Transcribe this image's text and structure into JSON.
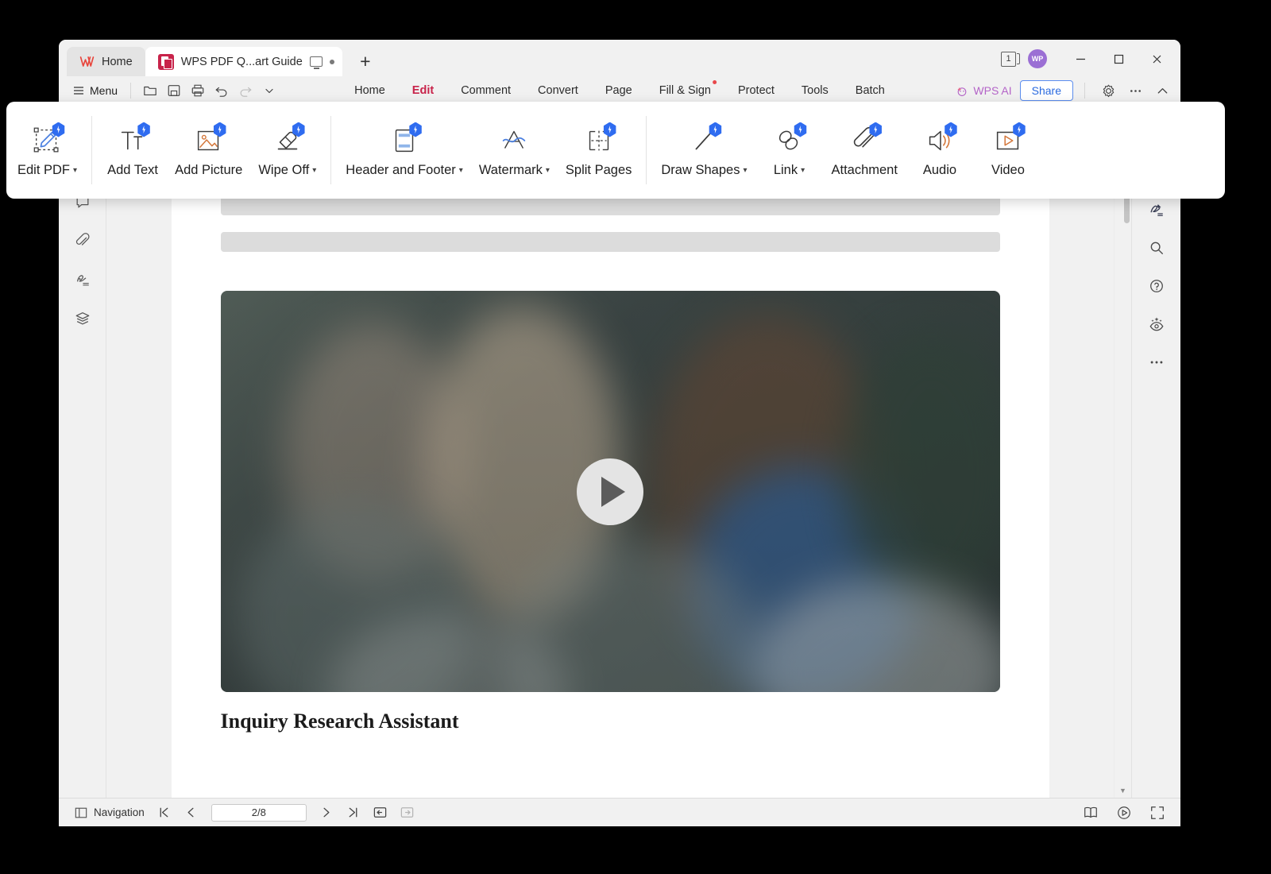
{
  "titlebar": {
    "tabs": [
      {
        "label": "Home",
        "icon": "wps-logo-icon",
        "active": false
      },
      {
        "label": "WPS PDF Q...art Guide",
        "icon": "pdf-doc-icon",
        "active": true
      }
    ],
    "new_tab_label": "+",
    "page_badge": "1",
    "avatar_initials": "WP",
    "window_controls": [
      "minimize",
      "maximize",
      "close"
    ]
  },
  "menubar": {
    "menu_label": "Menu",
    "quick_access": [
      "open-icon",
      "save-icon",
      "print-icon",
      "undo-icon",
      "redo-icon",
      "customize-chevron-icon"
    ],
    "tabs": [
      {
        "label": "Home",
        "active": false,
        "dot": false
      },
      {
        "label": "Edit",
        "active": true,
        "dot": false
      },
      {
        "label": "Comment",
        "active": false,
        "dot": false
      },
      {
        "label": "Convert",
        "active": false,
        "dot": false
      },
      {
        "label": "Page",
        "active": false,
        "dot": false
      },
      {
        "label": "Fill & Sign",
        "active": false,
        "dot": true
      },
      {
        "label": "Protect",
        "active": false,
        "dot": false
      },
      {
        "label": "Tools",
        "active": false,
        "dot": false
      },
      {
        "label": "Batch",
        "active": false,
        "dot": false
      }
    ],
    "wps_ai_label": "WPS AI",
    "share_label": "Share",
    "right_icons": [
      "settings-gear-icon",
      "more-options-icon",
      "collapse-ribbon-icon"
    ]
  },
  "ribbon": {
    "groups": [
      {
        "items": [
          {
            "label": "Edit PDF",
            "icon": "edit-pdf-icon",
            "caret": true,
            "ai": true
          }
        ]
      },
      {
        "items": [
          {
            "label": "Add Text",
            "icon": "add-text-icon",
            "caret": false,
            "ai": true
          },
          {
            "label": "Add Picture",
            "icon": "add-picture-icon",
            "caret": false,
            "ai": true
          },
          {
            "label": "Wipe Off",
            "icon": "wipe-off-icon",
            "caret": true,
            "ai": true
          }
        ]
      },
      {
        "items": [
          {
            "label": "Header and Footer",
            "icon": "header-footer-icon",
            "caret": true,
            "ai": true
          },
          {
            "label": "Watermark",
            "icon": "watermark-icon",
            "caret": true,
            "ai": false
          },
          {
            "label": "Split Pages",
            "icon": "split-pages-icon",
            "caret": false,
            "ai": true
          }
        ]
      },
      {
        "items": [
          {
            "label": "Draw Shapes",
            "icon": "draw-shapes-icon",
            "caret": true,
            "ai": true
          },
          {
            "label": "Link",
            "icon": "link-icon",
            "caret": true,
            "ai": true
          },
          {
            "label": "Attachment",
            "icon": "attachment-icon",
            "caret": false,
            "ai": true
          },
          {
            "label": "Audio",
            "icon": "audio-icon",
            "caret": false,
            "ai": true
          },
          {
            "label": "Video",
            "icon": "video-icon",
            "caret": false,
            "ai": true
          }
        ]
      }
    ]
  },
  "left_rail": {
    "items": [
      {
        "icon": "bookmark-icon"
      },
      {
        "icon": "thumbnail-image-icon"
      },
      {
        "icon": "comment-icon"
      },
      {
        "icon": "attachment-clip-icon"
      },
      {
        "icon": "signature-icon"
      },
      {
        "icon": "layers-icon"
      }
    ]
  },
  "right_rail": {
    "items": [
      {
        "icon": "annotate-edit-icon"
      },
      {
        "icon": "export-document-icon"
      },
      {
        "icon": "signature-pen-icon"
      },
      {
        "icon": "search-icon"
      },
      {
        "icon": "help-circle-icon"
      },
      {
        "icon": "smart-eye-icon"
      },
      {
        "icon": "more-dots-icon"
      }
    ]
  },
  "document": {
    "heading": "Inquiry Research Assistant",
    "media_play_label": "play-video",
    "skeleton_blocks": [
      "title-block",
      "line-1",
      "line-2",
      "line-3"
    ]
  },
  "statusbar": {
    "navigation_label": "Navigation",
    "first_page_icon": "first-page-icon",
    "prev_page_icon": "prev-page-icon",
    "page_indicator": "2/8",
    "next_page_icon": "next-page-icon",
    "last_page_icon": "last-page-icon",
    "back_view_icon": "back-view-icon",
    "forward_view_icon": "forward-view-icon",
    "right_icons": [
      "facing-pages-icon",
      "presentation-icon",
      "fullscreen-icon"
    ]
  },
  "colors": {
    "accent_red": "#c8234a",
    "ai_blue": "#2f6cf0",
    "share_blue": "#2a6adf",
    "wps_ai_purple": "#b464c8",
    "window_bg": "#f1f1f1",
    "avatar": "#9b6fd4"
  }
}
